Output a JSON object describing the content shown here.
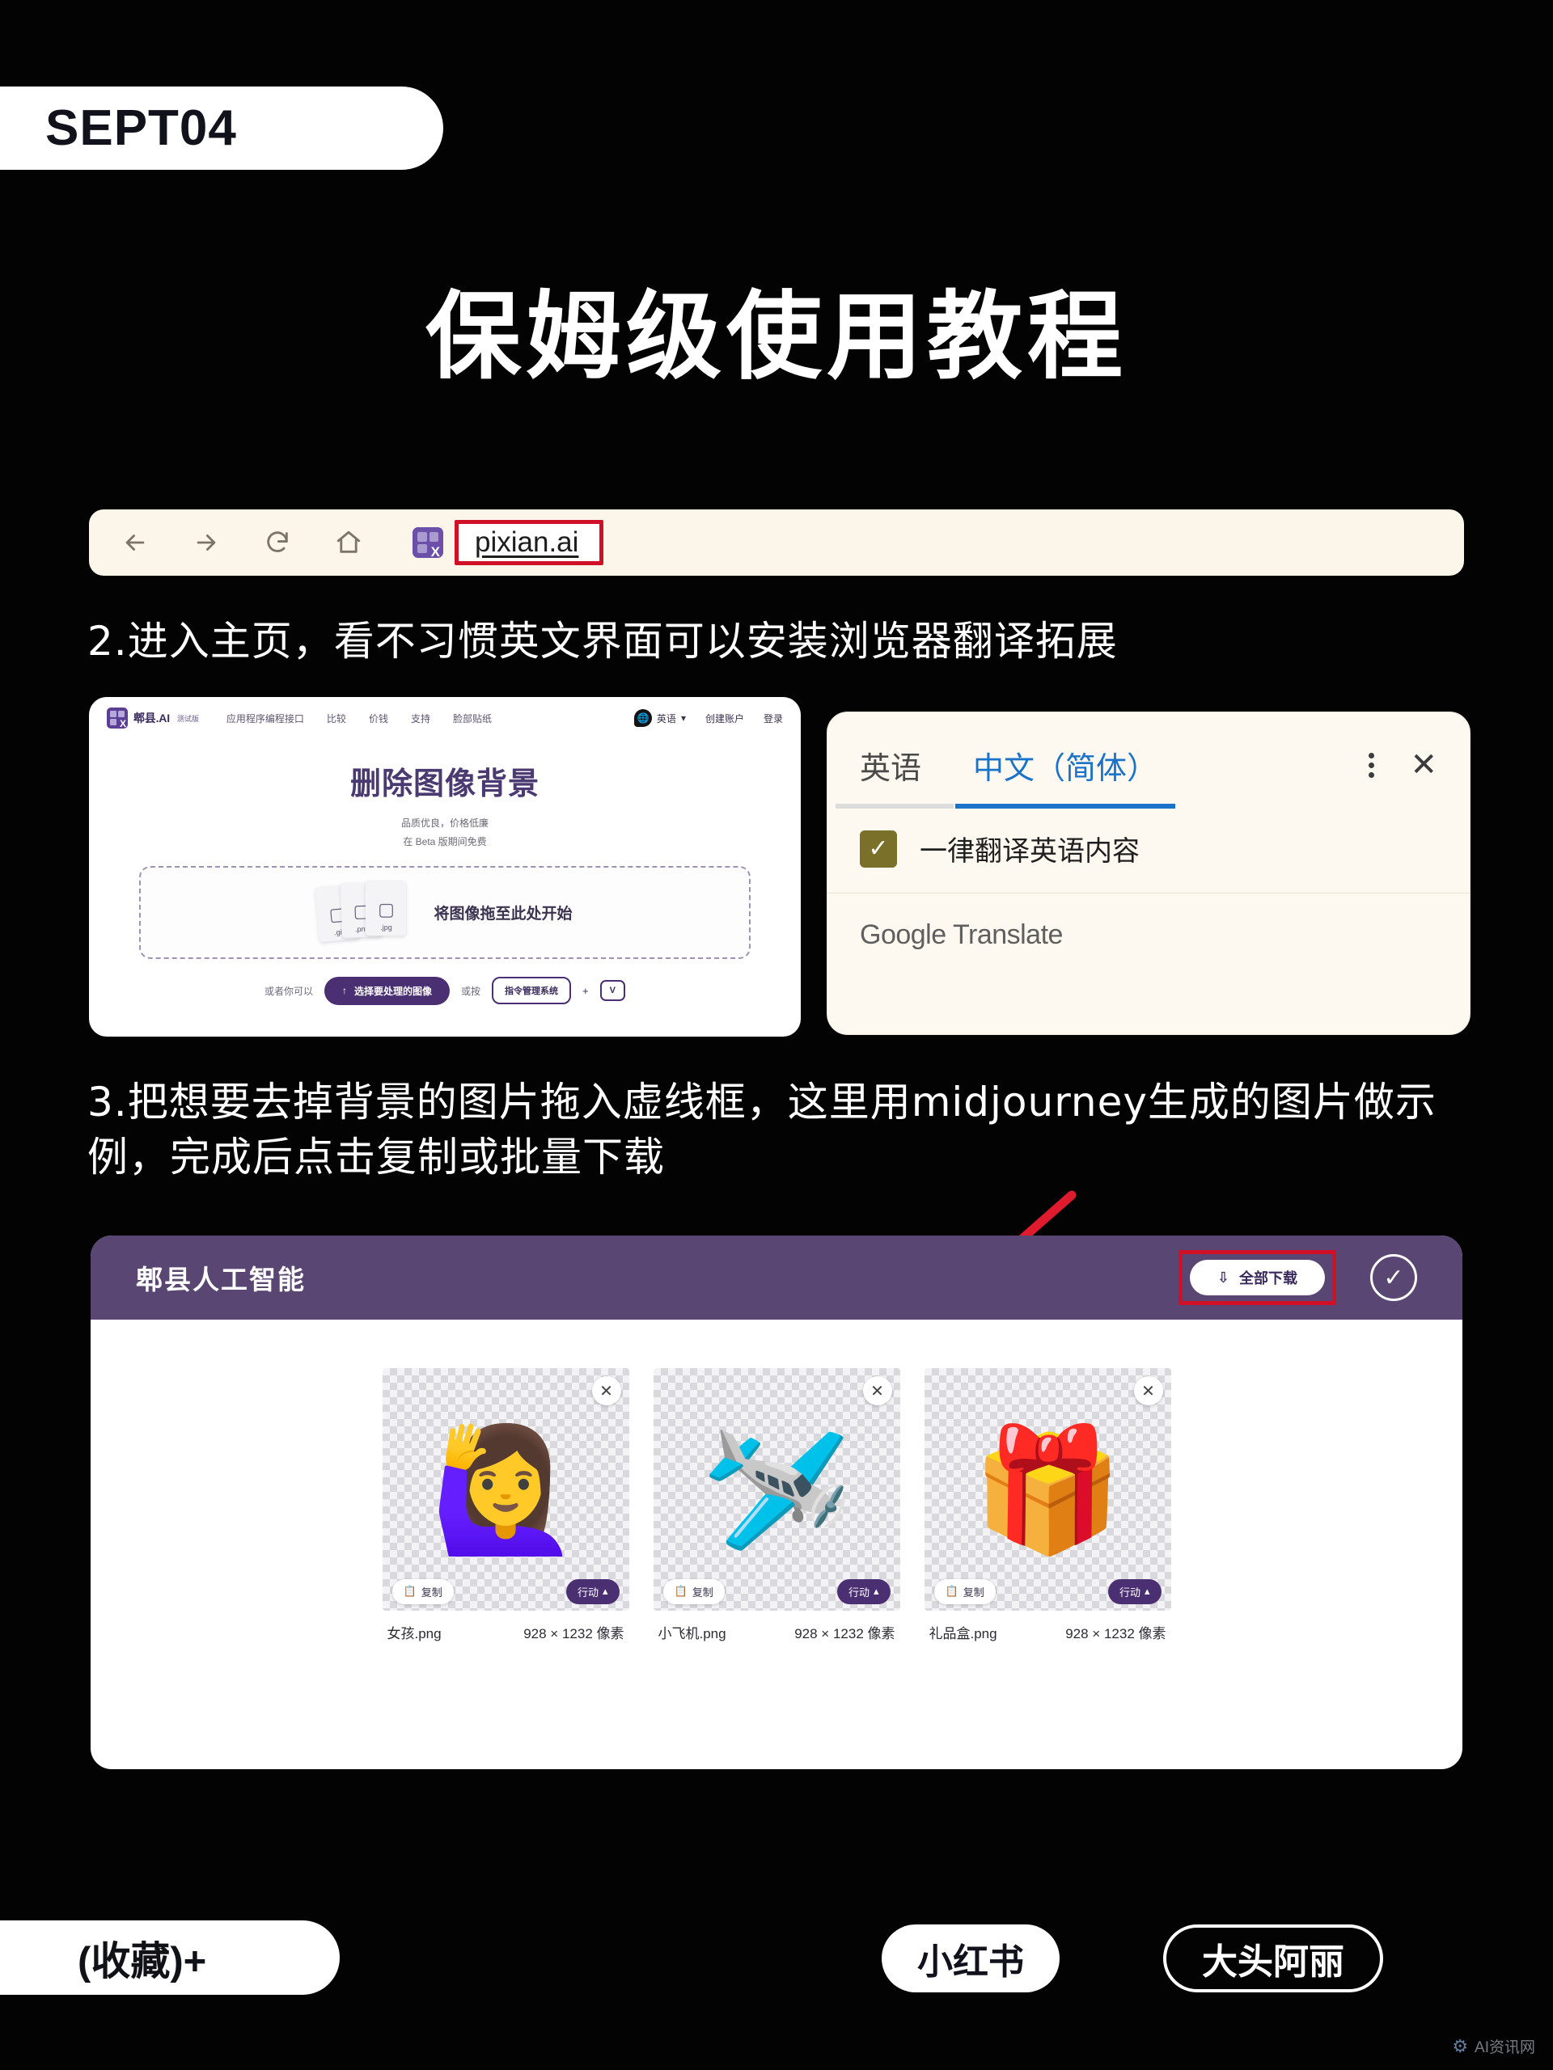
{
  "header": {
    "date_badge": "SEPT04",
    "main_title": "保姆级使用教程"
  },
  "browser": {
    "icons": {
      "back": "back-arrow-icon",
      "forward": "forward-arrow-icon",
      "reload": "reload-icon",
      "home": "home-icon"
    },
    "favicon_label": "X",
    "url": "pixian.ai"
  },
  "steps": {
    "step2": "2.进入主页，看不习惯英文界面可以安装浏览器翻译拓展",
    "step3": "3.把想要去掉背景的图片拖入虚线框，这里用midjourney生成的图片做示例，完成后点击复制或批量下载"
  },
  "website": {
    "logo_text": "郫县.AI",
    "logo_beta": "测试版",
    "logo_mark_x": "X",
    "menu": [
      "应用程序编程接口",
      "比较",
      "价钱",
      "支持",
      "脸部贴纸"
    ],
    "language": "英语",
    "language_caret": "▾",
    "create_account": "创建账户",
    "sign_in": "登录",
    "h1": "删除图像背景",
    "sub1": "品质优良，价格低廉",
    "sub2": "在 Beta 版期间免费",
    "dropzone_text": "将图像拖至此处开始",
    "file_exts": [
      ".gif",
      ".png",
      ".jpg"
    ],
    "or_you_can": "或者你可以",
    "primary_button": "选择要处理的图像",
    "or_press": "或按",
    "outline_button": "指令管理系统",
    "plus": "+",
    "key_v": "V"
  },
  "translate": {
    "tab_source": "英语",
    "tab_target": "中文（简体）",
    "menu_icon": "kebab-menu-icon",
    "close_icon": "✕",
    "checkbox_checked": true,
    "checkbox_label": "一律翻译英语内容",
    "brand_google": "Google",
    "brand_translate": "Translate",
    "accent_blue": "#1a73c8",
    "checkbox_color": "#7a7029",
    "background": "#fdf8f0"
  },
  "app": {
    "title": "郫县人工智能",
    "download_all": "全部下载",
    "download_icon": "download-icon",
    "confirm_icon": "✓",
    "header_color": "#5a4672",
    "highlight_color": "#d01026",
    "images": [
      {
        "emoji": "🙋‍♀️",
        "name": "女孩.png",
        "dimensions": "928 × 1232 像素",
        "copy": "复制",
        "action": "行动"
      },
      {
        "emoji": "🛩️",
        "name": "小飞机.png",
        "dimensions": "928 × 1232 像素",
        "copy": "复制",
        "action": "行动"
      },
      {
        "emoji": "🎁",
        "name": "礼品盒.png",
        "dimensions": "928 × 1232 像素",
        "copy": "复制",
        "action": "行动"
      }
    ]
  },
  "footer": {
    "collect": "(收藏)+",
    "platform": "小红书",
    "author": "大头阿丽",
    "watermark": "AI资讯网"
  }
}
